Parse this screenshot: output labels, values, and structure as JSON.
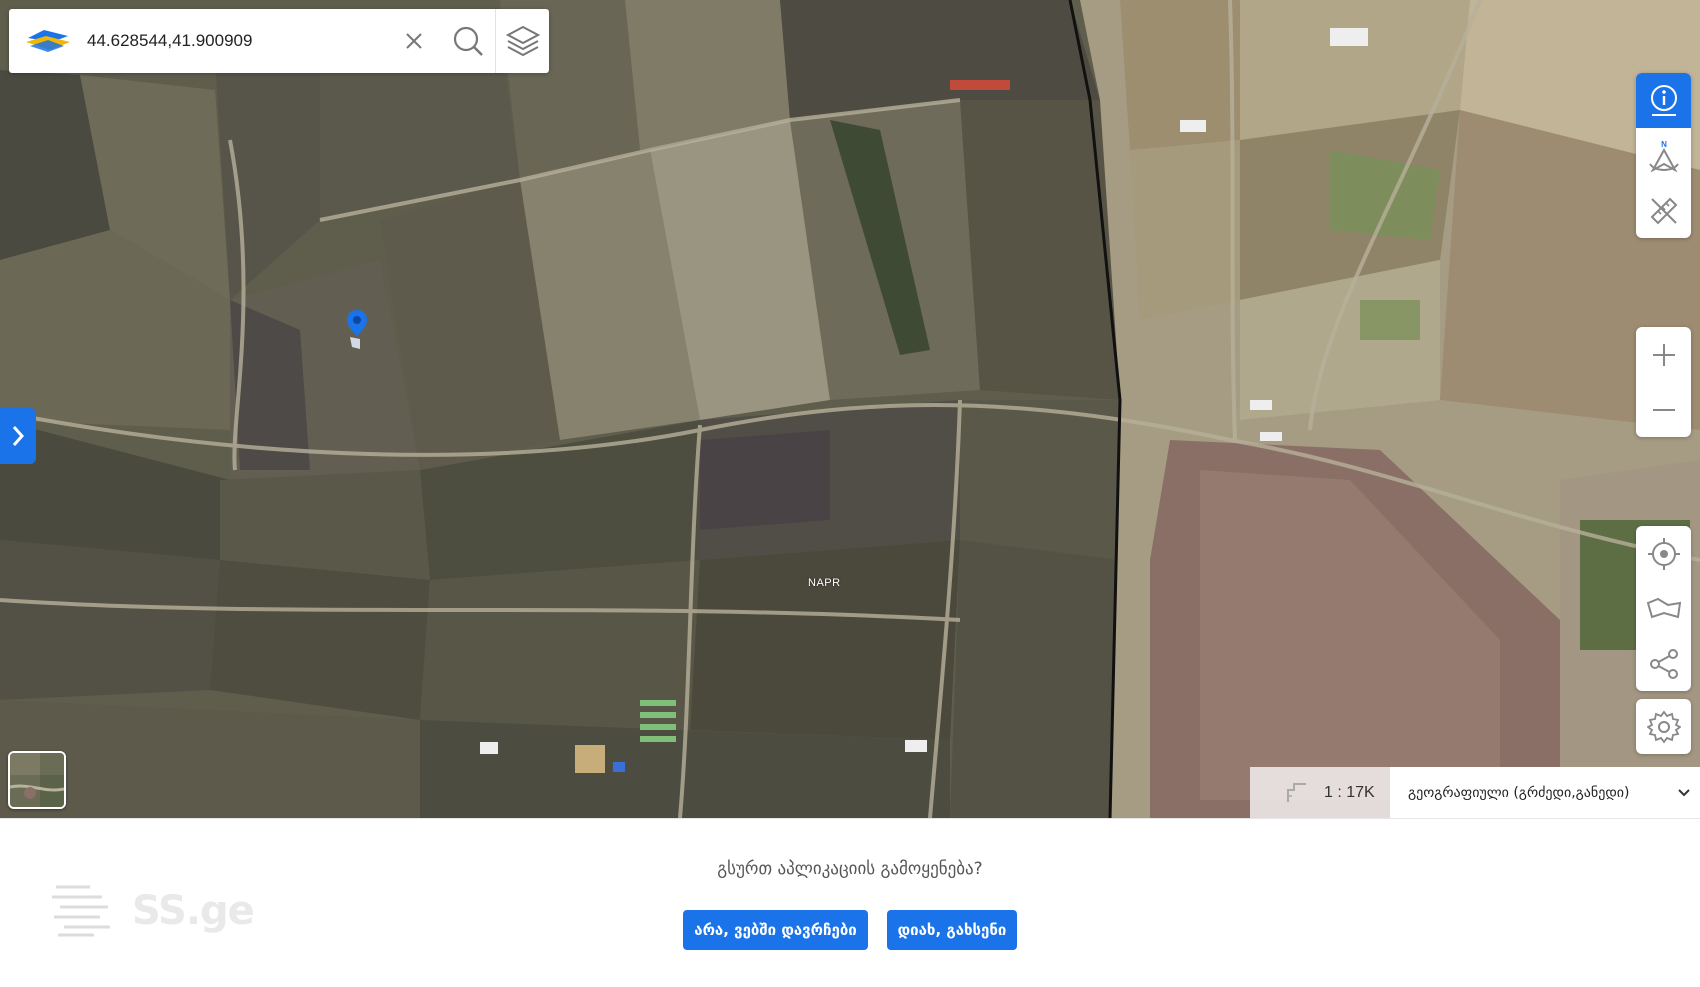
{
  "search": {
    "value": "44.628544,41.900909",
    "clear_icon": "close-icon",
    "search_icon": "search-icon",
    "layers_icon": "layers-icon"
  },
  "map": {
    "label": "NAPR",
    "marker_icon": "location-pin-icon",
    "accent": "#1a73e8"
  },
  "toolbar_top": [
    "info-icon",
    "north-arrow-icon",
    "measure-icon"
  ],
  "toolbar_zoom": [
    "zoom-in-icon",
    "zoom-out-icon"
  ],
  "toolbar_bottom": [
    "locate-icon",
    "draw-area-icon",
    "share-icon",
    "settings-icon"
  ],
  "scale": {
    "text": "1 : 17K"
  },
  "projection": {
    "value": "გეოგრაფიული (გრძედი,განედი)"
  },
  "banner": {
    "brand": "SS.ge",
    "question": "გსურთ აპლიკაციის გამოყენება?",
    "no_label": "არა, ვებში დავრჩები",
    "yes_label": "დიახ, გახსენი"
  }
}
